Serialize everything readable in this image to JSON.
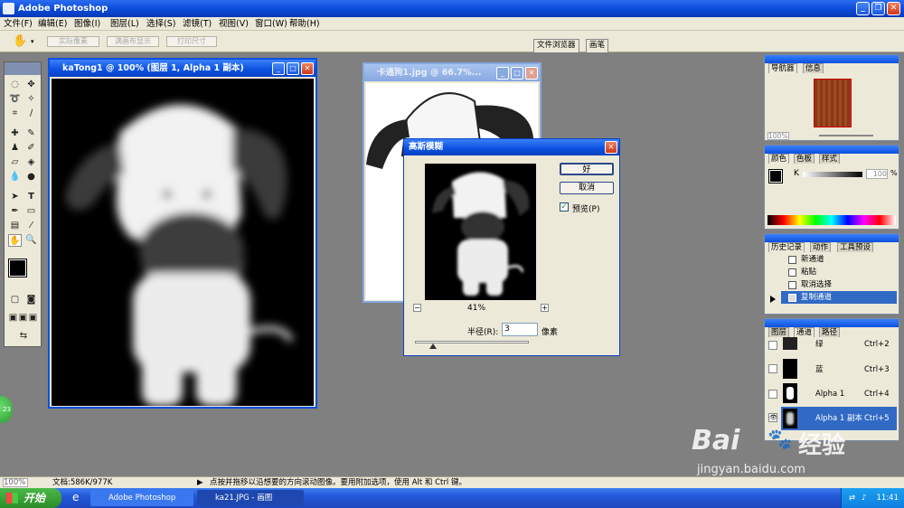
{
  "app": {
    "title": "Adobe Photoshop"
  },
  "menu": [
    "文件(F)",
    "编辑(E)",
    "图像(I)",
    "图层(L)",
    "选择(S)",
    "滤镜(T)",
    "视图(V)",
    "窗口(W)",
    "帮助(H)"
  ],
  "options": {
    "actual_pixels": "实际像素",
    "fit_screen": "满画布显示",
    "print_size": "打印尺寸"
  },
  "well_tabs": [
    "文件浏览器",
    "画笔"
  ],
  "doc1": {
    "title": "kaTong1 @ 100% (图层 1, Alpha 1 副本)"
  },
  "doc2": {
    "title": "卡通狗1.jpg @ 66.7%..."
  },
  "dialog": {
    "title": "高斯模糊",
    "ok": "好",
    "cancel": "取消",
    "preview_label": "预览(P)",
    "zoom": "41%",
    "radius_label": "半径(R):",
    "radius_value": "3",
    "unit": "像素",
    "zoom_out": "−",
    "zoom_in": "+"
  },
  "navigator": {
    "tabs": [
      "导航器",
      "信息"
    ],
    "zoom": "100%"
  },
  "color": {
    "tabs": [
      "颜色",
      "色板",
      "样式"
    ],
    "channel": "K",
    "value": "100",
    "unit": "%"
  },
  "history": {
    "tabs": [
      "历史记录",
      "动作",
      "工具预设"
    ],
    "items": [
      "新通道",
      "粘贴",
      "取消选择",
      "复制通道"
    ]
  },
  "channels": {
    "tabs": [
      "图层",
      "通道",
      "路径"
    ],
    "rows": [
      {
        "name": "绿",
        "shortcut": "Ctrl+2"
      },
      {
        "name": "蓝",
        "shortcut": "Ctrl+3"
      },
      {
        "name": "Alpha 1",
        "shortcut": "Ctrl+4"
      },
      {
        "name": "Alpha 1 副本",
        "shortcut": "Ctrl+5"
      }
    ]
  },
  "status": {
    "zoom": "100%",
    "doc_size": "文档:586K/977K",
    "hint": "点按并拖移以沿想要的方向滚动图像。要用附加选项，使用 Alt 和 Ctrl 键。"
  },
  "taskbar": {
    "start": "开始",
    "tasks": [
      "Adobe Photoshop",
      "ka21.JPG - 画图"
    ],
    "clock": "11:41",
    "badge": "23"
  },
  "watermark": {
    "brand": "Bai",
    "brand2": "经验",
    "url": "jingyan.baidu.com"
  },
  "colors": {
    "titlebar": "#0a50e0",
    "selected_row": "#316ac5",
    "canvas_bg": "#808080",
    "ui_face": "#ece9d8"
  }
}
